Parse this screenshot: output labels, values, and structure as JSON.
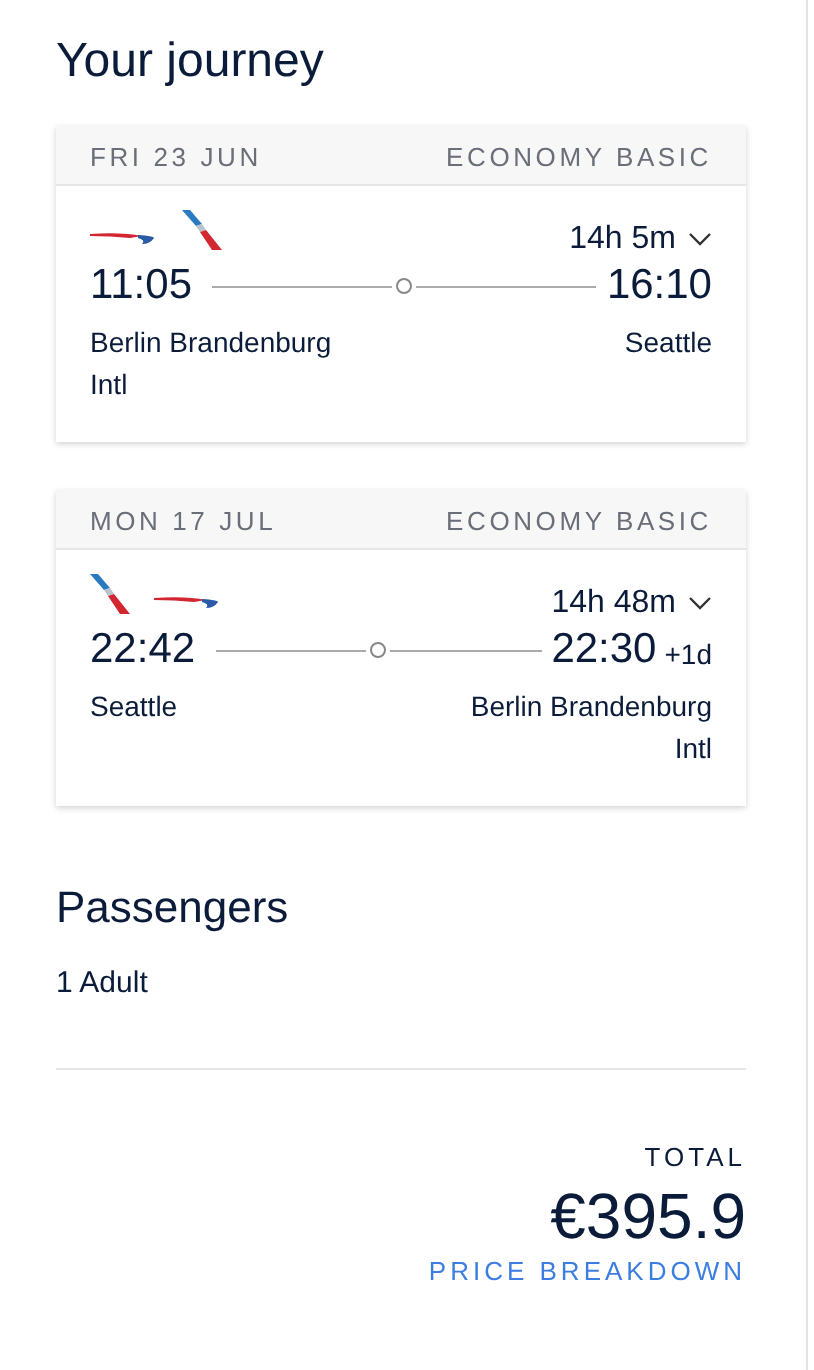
{
  "title": "Your journey",
  "legs": [
    {
      "date": "FRI 23 JUN",
      "cabin": "ECONOMY BASIC",
      "logos": [
        {
          "kind": "swoosh"
        },
        {
          "kind": "tail"
        }
      ],
      "duration": "14h 5m",
      "expanded": false,
      "depart_time": "11:05",
      "arrive_time": "16:10",
      "origin": "Berlin Brandenburg Intl",
      "destination": "Seattle"
    },
    {
      "date": "MON 17 JUL",
      "cabin": "ECONOMY BASIC",
      "logos": [
        {
          "kind": "tail"
        },
        {
          "kind": "swoosh"
        }
      ],
      "duration": "14h 48m",
      "expanded": false,
      "depart_time": "22:42",
      "arrive_time": "22:30",
      "day_offset": "+1d",
      "origin": "Seattle",
      "destination": "Berlin Brandenburg Intl"
    }
  ],
  "passengers": {
    "heading": "Passengers",
    "summary": "1 Adult"
  },
  "total": {
    "label": "TOTAL",
    "amount": "€395.9",
    "link": "PRICE BREAKDOWN"
  }
}
